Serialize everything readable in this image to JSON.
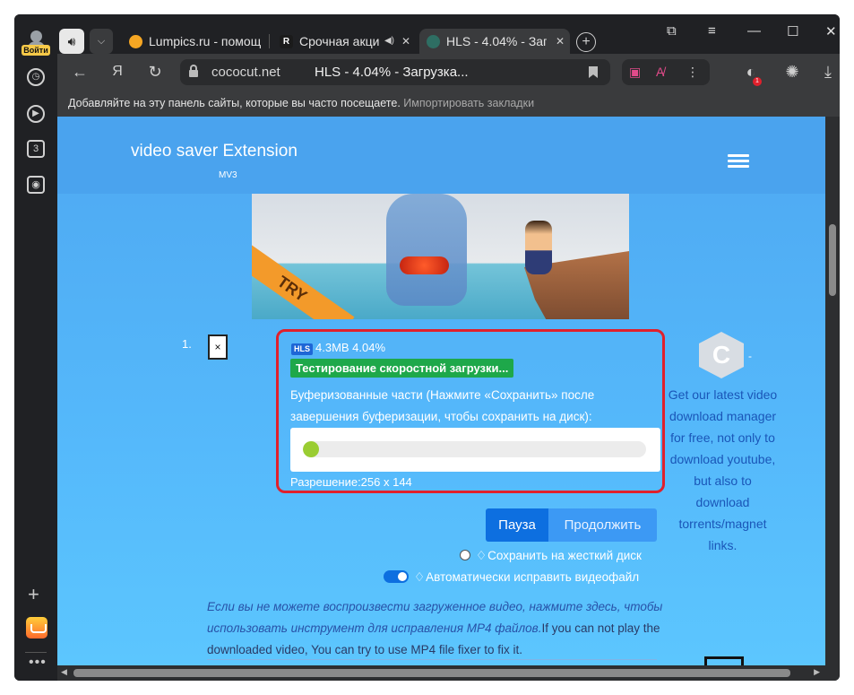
{
  "sidebar": {
    "login_label": "Войти",
    "icons": [
      "history-icon",
      "player-icon",
      "tab-count-icon",
      "screenshot-icon"
    ],
    "tab_count": "3",
    "add_label": "+",
    "more_label": "•••"
  },
  "tabs": [
    {
      "title": "Lumpics.ru - помощ",
      "favicon_color": "#f5a623",
      "active": false
    },
    {
      "title": "Срочная акци",
      "favicon_color": "#1b1b1b",
      "active": false,
      "favicon_letter": "R",
      "muted_icon": "speaker-icon"
    },
    {
      "title": "HLS - 4.04% - Загр",
      "favicon_color": "#2e6e63",
      "active": true
    }
  ],
  "toolbar": {
    "domain": "cococut.net",
    "page_title": "HLS - 4.04% - Загрузка...",
    "yandex_label": "Я"
  },
  "bookmarks_bar": {
    "text": "Добавляйте на эту панель сайты, которые вы часто посещаете.",
    "link": "Импортировать закладки"
  },
  "site": {
    "brand": "video saver Extension",
    "brand_sub": "MV3",
    "thumbnail_label": "TRY",
    "item_index": "1.",
    "close_label": "×",
    "hls_badge": "HLS",
    "meta": "4.3MB 4.04%",
    "status": "Тестирование скоростной загрузки...",
    "description": "Буферизованные части (Нажмите «Сохранить» после завершения буферизации, чтобы сохранить на диск):",
    "progress_fraction": 0.04,
    "resolution": "Разрешение:256 x 144",
    "pause_label": "Пауза",
    "continue_label": "Продолжить",
    "save_option": "Сохранить на жесткий диск",
    "autofix_option": "Автоматически исправить видеофайл",
    "note_ru": "Если вы не можете воспроизвести загруженное видео, нажмите здесь, чтобы использовать инструмент для исправления MP4 файлов.",
    "note_en": "If you can not play the downloaded video, You can try to use MP4 file fixer to fix it."
  },
  "side_ad": {
    "logo_letter": "C",
    "dash": "-",
    "text": "Get our latest video download manager for free, not only to download youtube, but also to download torrents/magnet links."
  },
  "colors": {
    "accent_red": "#e0202c",
    "button_blue": "#0d6fe0",
    "status_green": "#1ea84a",
    "page_blue": "#4aa3ee"
  }
}
